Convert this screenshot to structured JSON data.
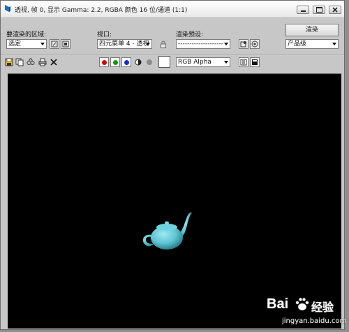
{
  "window": {
    "title": "透视, 帧 0, 显示 Gamma: 2.2, RGBA 颜色 16 位/通道 (1:1)",
    "icon": "render-frame-icon"
  },
  "controls": {
    "area_label": "要渲染的区域:",
    "area_value": "选定",
    "viewport_label": "视口:",
    "viewport_value": "四元菜单 4 - 透视",
    "preset_label": "渲染预设:",
    "preset_value": "--------------------",
    "render_button": "渲染",
    "quality_value": "产品级"
  },
  "toolbar": {
    "channel_value": "RGB Alpha",
    "channel_colors": {
      "red": "#d40000",
      "green": "#0a9a0a",
      "blue": "#1a2cd0"
    }
  },
  "render": {
    "background": "#000000",
    "object": "teapot",
    "object_color": "#5fc6d4"
  },
  "watermark": {
    "brand": "Bai",
    "brand_suffix": "经验",
    "url": "jingyan.baidu.com"
  }
}
